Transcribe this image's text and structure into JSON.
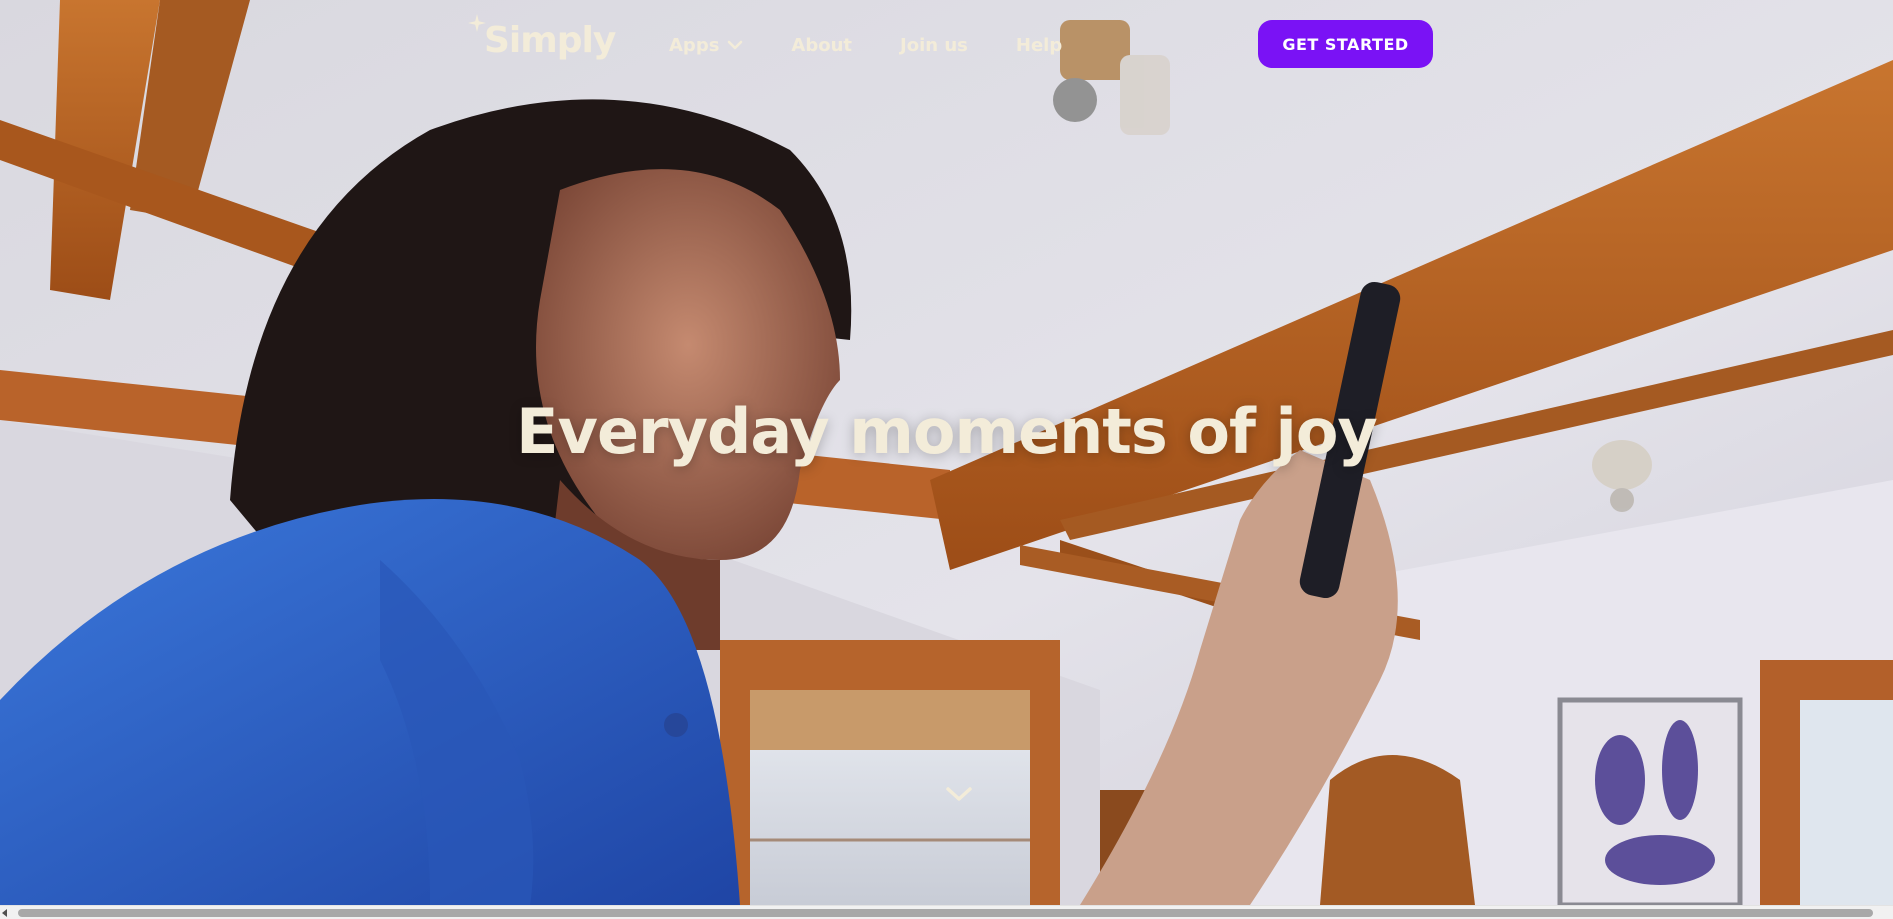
{
  "brand": {
    "name": "Simply",
    "icon": "sparkle-icon"
  },
  "nav": {
    "items": [
      {
        "label": "Apps",
        "has_dropdown": true,
        "icon": "chevron-down-icon"
      },
      {
        "label": "About"
      },
      {
        "label": "Join us"
      },
      {
        "label": "Help"
      }
    ],
    "cta_label": "GET STARTED"
  },
  "hero": {
    "headline": "Everyday moments of joy",
    "scroll_icon": "chevron-down-icon"
  },
  "colors": {
    "accent": "#7a12f5",
    "text_light": "#f3ecd9",
    "wood": "#b25a1e",
    "shirt": "#2f5fc4"
  }
}
